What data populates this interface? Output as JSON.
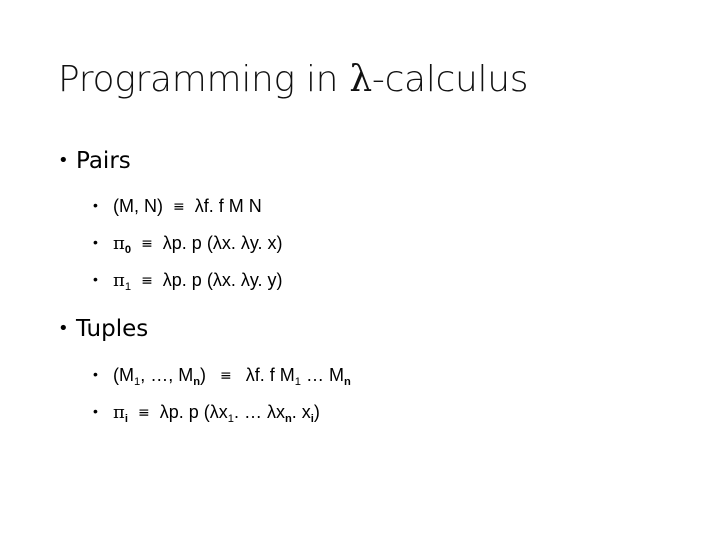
{
  "slide": {
    "title_prefix": "Programming in ",
    "title_lambda": "λ",
    "title_suffix": "-calculus",
    "sections": [
      {
        "heading": "Pairs",
        "items": [
          {
            "lhs": "(M, N)",
            "equiv": "≡",
            "rhs": "λf. f M N"
          },
          {
            "lhs_sym": "π",
            "lhs_sub": "0",
            "equiv": "≡",
            "rhs": "λp. p (λx. λy. x)"
          },
          {
            "lhs_sym": "π",
            "lhs_sub": "1",
            "equiv": "≡",
            "rhs": "λp. p (λx. λy. y)"
          }
        ]
      },
      {
        "heading": "Tuples",
        "items": [
          {
            "lhs_open": "(M",
            "lhs_sub1": "1",
            "lhs_mid": ", …, M",
            "lhs_subn": "n",
            "lhs_close": ")",
            "equiv": "≡",
            "rhs_pre": "λf. f M",
            "rhs_sub1": "1",
            "rhs_mid": " … M",
            "rhs_subn": "n"
          },
          {
            "lhs_sym": "π",
            "lhs_sub": "i",
            "equiv": "≡",
            "rhs_pre": "λp. p (λx",
            "rhs_sub1": "1",
            "rhs_mid": ". … λx",
            "rhs_subn": "n",
            "rhs_mid2": ". x",
            "rhs_subi": "i",
            "rhs_close": ")"
          }
        ]
      }
    ],
    "bullet": "•"
  }
}
